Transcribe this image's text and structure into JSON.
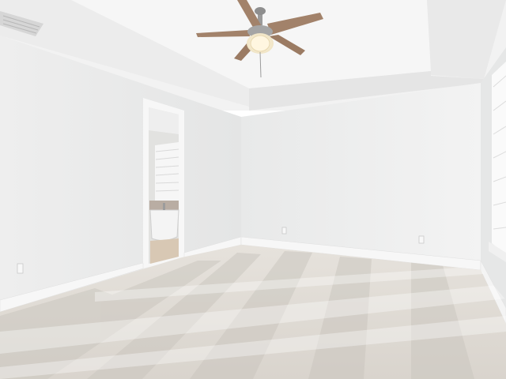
{
  "scene": {
    "subject": "empty-bedroom",
    "features": [
      "tray-ceiling",
      "ceiling-fan",
      "doorway-to-bathroom",
      "freestanding-bathtub",
      "window-blinds",
      "carpet",
      "baseboards",
      "wall-outlets",
      "air-vent"
    ]
  },
  "colors": {
    "ceiling": "#f1f1f1",
    "wall_left": "#e9eaea",
    "wall_back": "#efefef",
    "wall_right": "#e6e7e7",
    "carpet": "#ddd8d1",
    "carpet_stripe": "#cbc6bf",
    "fan_blade": "#a2826a",
    "fan_metal": "#9a9a9a",
    "light_glow": "#fff6e0",
    "baseboard": "#f7f7f7"
  }
}
